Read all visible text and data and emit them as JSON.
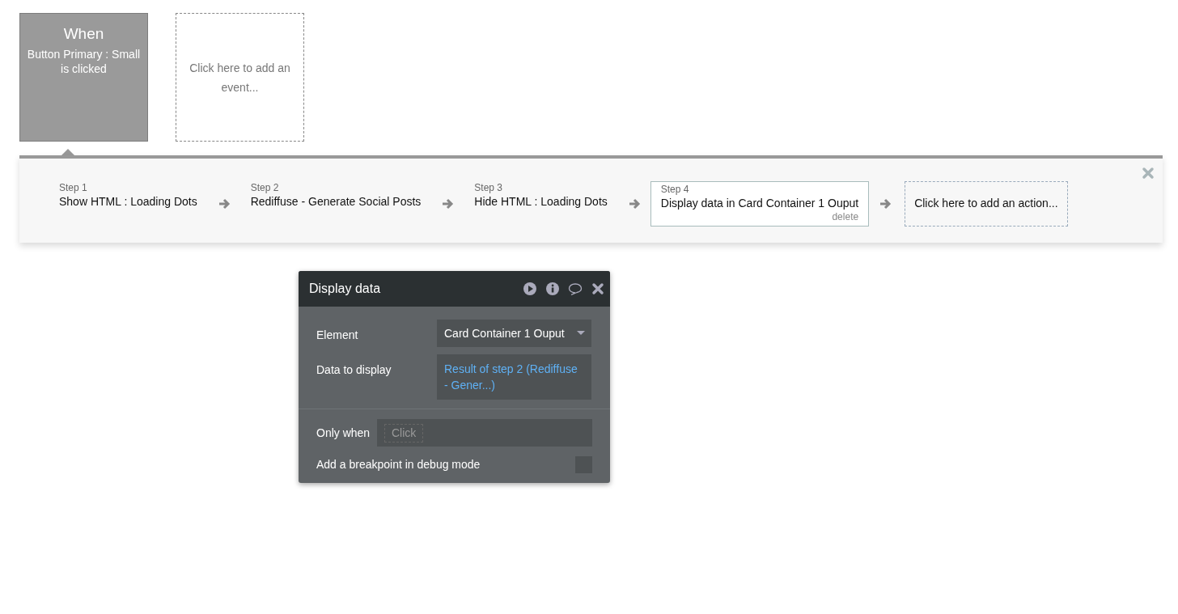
{
  "events": [
    {
      "kind": "event",
      "title": "When",
      "description": "Button Primary : Small is clicked",
      "selected": true
    },
    {
      "kind": "add",
      "label": "Click here to add an event..."
    }
  ],
  "steps": [
    {
      "number": "Step 1",
      "label": "Show HTML : Loading Dots",
      "selected": false
    },
    {
      "number": "Step 2",
      "label": "Rediffuse - Generate Social Posts",
      "selected": false
    },
    {
      "number": "Step 3",
      "label": "Hide HTML : Loading Dots",
      "selected": false
    },
    {
      "number": "Step 4",
      "label": "Display data in Card Container 1 Ouput",
      "selected": true,
      "delete": "delete"
    }
  ],
  "add_action": "Click here to add an action...",
  "editor": {
    "title": "Display data",
    "fields": [
      {
        "kind": "dropdown",
        "label": "Element",
        "value": "Card Container 1 Ouput"
      },
      {
        "kind": "expression",
        "label": "Data to display",
        "value": "Result of step 2 (Rediffuse - Gener...)"
      }
    ],
    "only_when": {
      "label": "Only when",
      "placeholder": "Click"
    },
    "breakpoint": {
      "label": "Add a breakpoint in debug mode",
      "checked": false
    }
  }
}
